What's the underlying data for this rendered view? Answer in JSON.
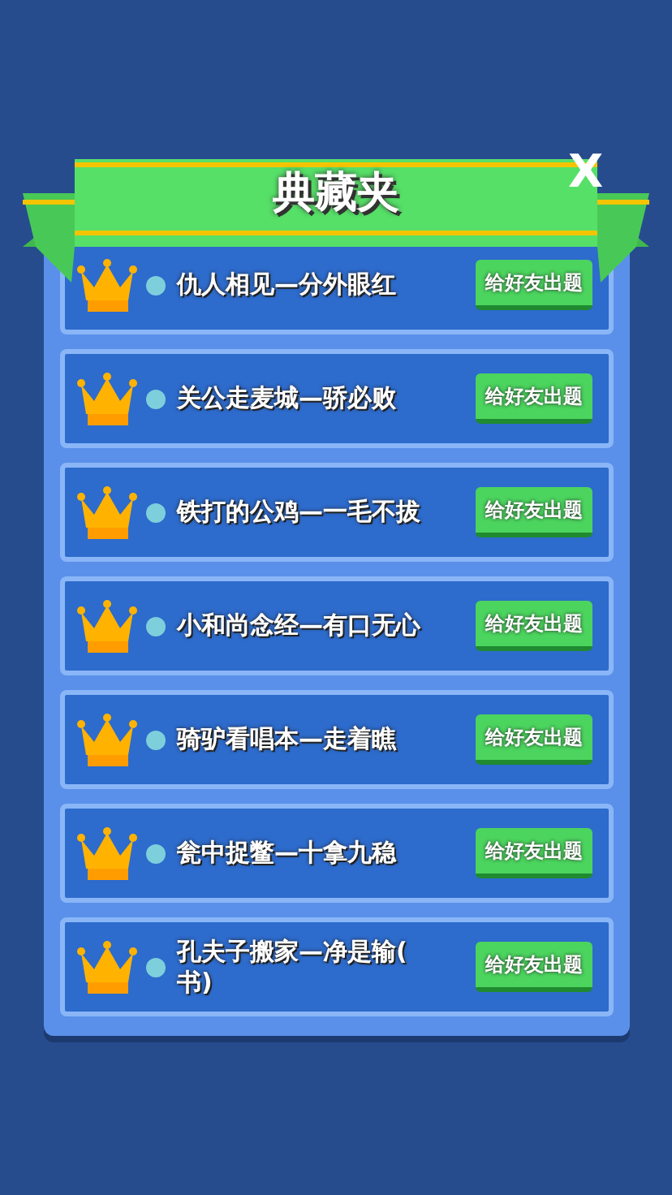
{
  "header": {
    "title": "典藏夹",
    "close": "X"
  },
  "items": [
    {
      "text": "仇人相见—分外眼红",
      "button": "给好友出题"
    },
    {
      "text": "关公走麦城—骄必败",
      "button": "给好友出题"
    },
    {
      "text": "铁打的公鸡—一毛不拔",
      "button": "给好友出题"
    },
    {
      "text": "小和尚念经—有口无心",
      "button": "给好友出题"
    },
    {
      "text": "骑驴看唱本—走着瞧",
      "button": "给好友出题"
    },
    {
      "text": "瓮中捉鳖—十拿九稳",
      "button": "给好友出题"
    },
    {
      "text": "孔夫子搬家—净是输(书)",
      "button": "给好友出题"
    }
  ]
}
